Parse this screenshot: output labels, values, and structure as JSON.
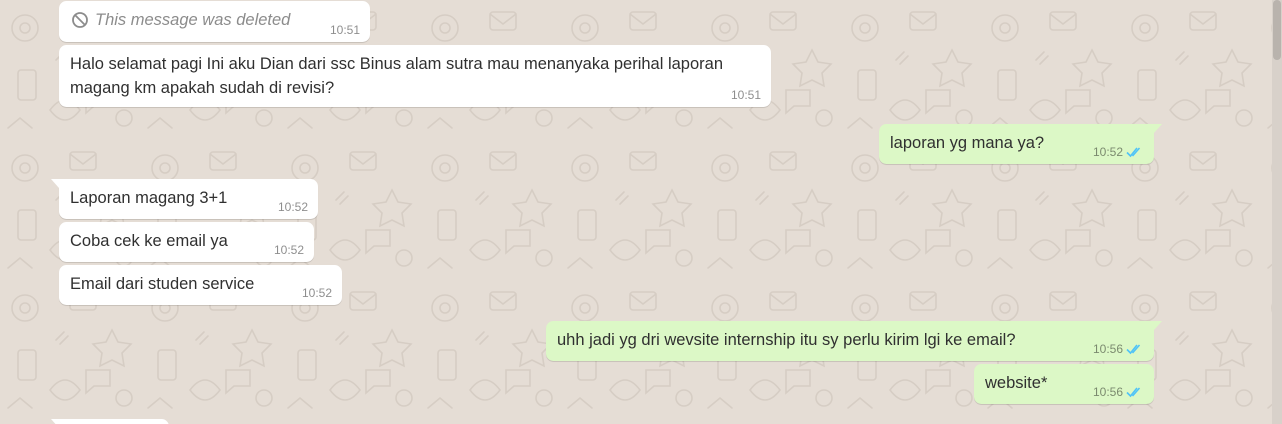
{
  "colors": {
    "wallpaper": "#e5ddd5",
    "incoming_bubble": "#ffffff",
    "outgoing_bubble": "#dcf8c6",
    "read_ticks": "#4fc3f7"
  },
  "messages": [
    {
      "direction": "incoming",
      "deleted": true,
      "text": "This message was deleted",
      "time": "10:51",
      "icon": "prohibited-icon"
    },
    {
      "direction": "incoming",
      "text": "Halo selamat pagi  Ini aku Dian dari ssc Binus alam sutra mau menanyaka perihal laporan magang km apakah sudah di revisi?",
      "time": "10:51"
    },
    {
      "direction": "outgoing",
      "text": "laporan yg mana ya?",
      "time": "10:52",
      "status_icon": "double-check-read-icon"
    },
    {
      "direction": "incoming",
      "text": "Laporan magang 3+1",
      "time": "10:52"
    },
    {
      "direction": "incoming",
      "text": "Coba cek ke email ya",
      "time": "10:52"
    },
    {
      "direction": "incoming",
      "text": "Email dari studen service",
      "time": "10:52"
    },
    {
      "direction": "outgoing",
      "text": "uhh jadi yg dri wevsite internship itu sy perlu kirim lgi ke email?",
      "time": "10:56",
      "status_icon": "double-check-read-icon"
    },
    {
      "direction": "outgoing",
      "text": "website*",
      "time": "10:56",
      "status_icon": "double-check-read-icon"
    }
  ]
}
